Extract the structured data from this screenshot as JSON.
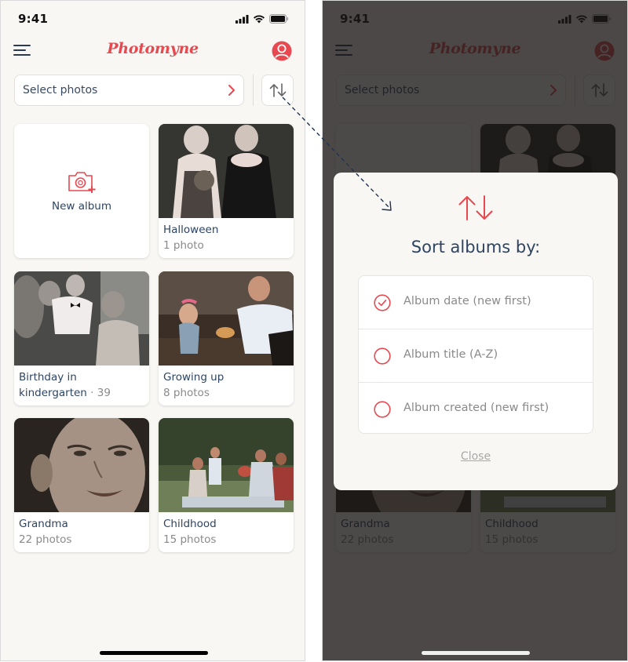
{
  "colors": {
    "accent": "#e8484f",
    "text_primary": "#2e4463",
    "text_secondary": "#8a8a8a",
    "background": "#f8f7f4"
  },
  "screens": [
    {
      "status_bar": {
        "time": "9:41",
        "icons": [
          "cellular-signal-icon",
          "wifi-icon",
          "battery-icon"
        ]
      },
      "header": {
        "logo": "Photomyne",
        "menu_icon": "hamburger-menu-icon",
        "profile_icon": "user-avatar-icon"
      },
      "toolbar": {
        "select_label": "Select photos",
        "select_icon": "chevron-right-icon",
        "sort_icon": "sort-arrows-icon"
      },
      "albums": [
        {
          "type": "new",
          "label": "New album",
          "icon": "camera-plus-icon"
        },
        {
          "title": "Halloween",
          "count": "1 photo"
        },
        {
          "title": "Birthday in",
          "title_line2": "kindergarten",
          "count": "· 39"
        },
        {
          "title": "Growing up",
          "count": "8 photos"
        },
        {
          "title": "Grandma",
          "count": "22 photos"
        },
        {
          "title": "Childhood",
          "count": "15 photos"
        }
      ]
    }
  ],
  "sort_modal": {
    "icon": "sort-arrows-icon",
    "title": "Sort albums by:",
    "options": [
      {
        "label": "Album date (new first)",
        "selected": true
      },
      {
        "label": "Album title (A-Z)",
        "selected": false
      },
      {
        "label": "Album created (new first)",
        "selected": false
      }
    ],
    "close_label": "Close"
  },
  "annotation": {
    "type": "dashed-arrow",
    "from": "sort-button",
    "to": "sort-modal"
  }
}
